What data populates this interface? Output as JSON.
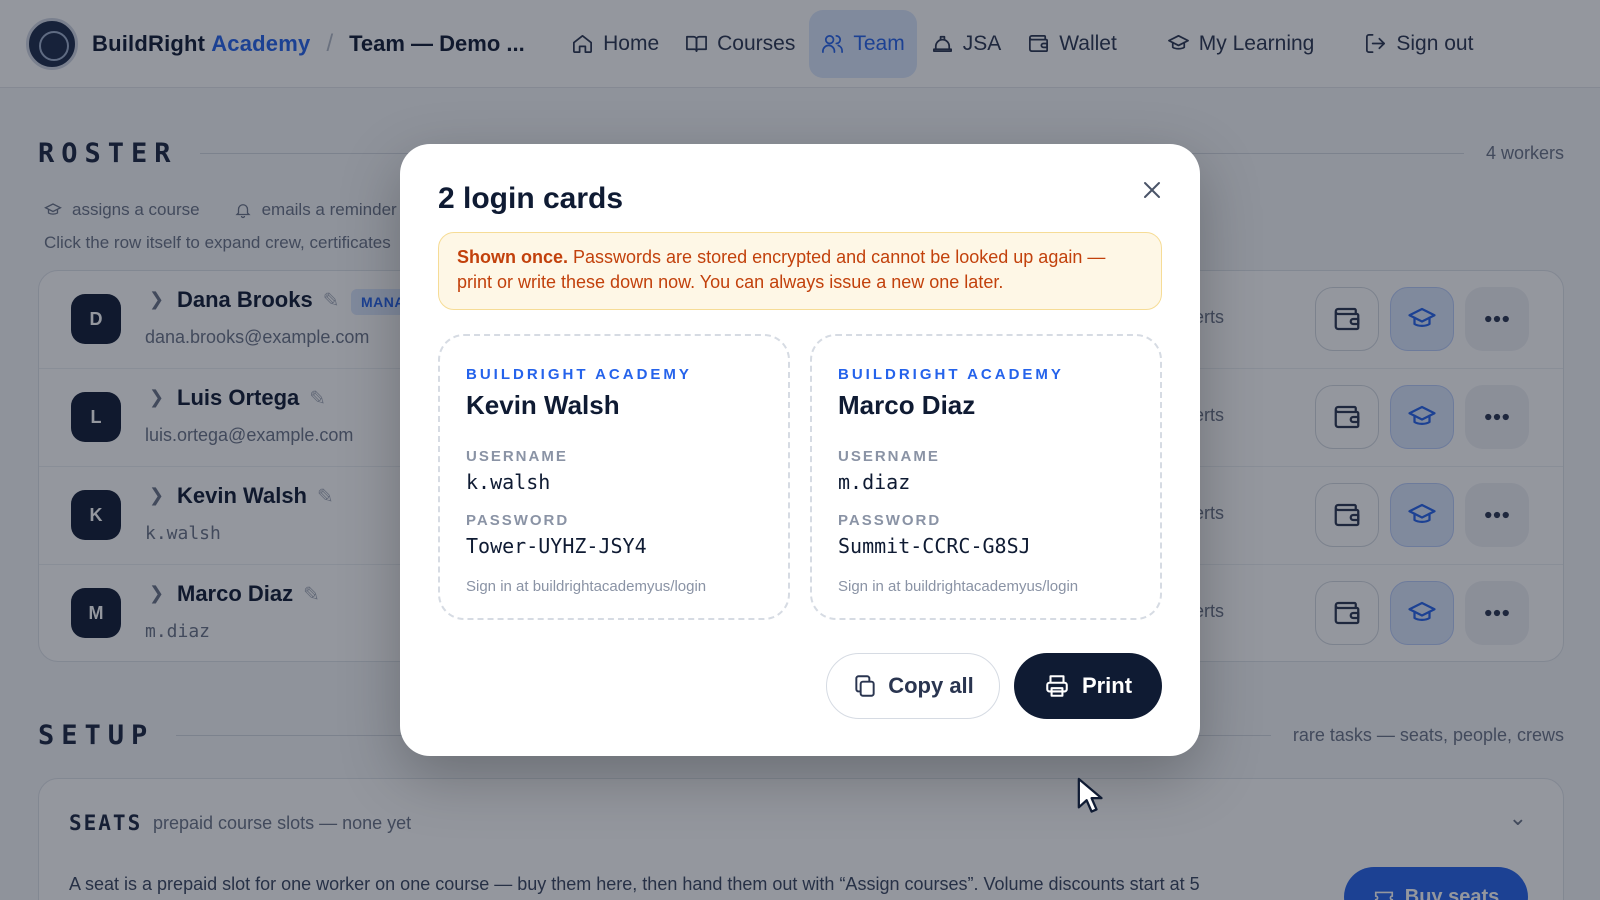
{
  "header": {
    "brand_part1": "BuildRight",
    "brand_part2": "Academy",
    "breadcrumb_separator": "/",
    "breadcrumb_current": "Team — Demo ...",
    "nav": [
      {
        "label": "Home",
        "icon": "home-icon",
        "active": false
      },
      {
        "label": "Courses",
        "icon": "book-icon",
        "active": false
      },
      {
        "label": "Team",
        "icon": "users-icon",
        "active": true
      },
      {
        "label": "JSA",
        "icon": "hard-hat-icon",
        "active": false
      },
      {
        "label": "Wallet",
        "icon": "wallet-icon",
        "active": false
      },
      {
        "label": "My Learning",
        "icon": "graduation-cap-icon",
        "active": false
      },
      {
        "label": "Sign out",
        "icon": "sign-out-icon",
        "active": false
      }
    ]
  },
  "roster": {
    "title": "ROSTER",
    "count": "4 workers",
    "legend": [
      {
        "icon": "graduation-cap-icon",
        "text": "assigns a course"
      },
      {
        "icon": "bell-icon",
        "text": "emails a reminder"
      }
    ],
    "hint": "Click  the row itself to expand crew, certificates",
    "workers": [
      {
        "initial": "D",
        "name": "Dana Brooks",
        "sub": "dana.brooks@example.com",
        "badge": "MANA",
        "certs": "erts"
      },
      {
        "initial": "L",
        "name": "Luis Ortega",
        "sub": "luis.ortega@example.com",
        "certs": "erts"
      },
      {
        "initial": "K",
        "name": "Kevin Walsh",
        "sub": "k.walsh",
        "certs": "erts"
      },
      {
        "initial": "M",
        "name": "Marco Diaz",
        "sub": "m.diaz",
        "certs": "erts"
      }
    ]
  },
  "setup": {
    "title": "SETUP",
    "meta": "rare tasks — seats, people, crews",
    "seats_title": "SEATS",
    "seats_sub": "prepaid course slots — none yet",
    "seats_desc": "A seat is a prepaid slot for one worker on one course — buy them here, then hand them out with “Assign courses”. Volume discounts start at 5",
    "buy_label": "Buy seats"
  },
  "modal": {
    "title": "2 login cards",
    "warning_strong": "Shown once.",
    "warning_text": " Passwords are stored encrypted and cannot be looked up again — print or write these down now. You can always issue a new one later.",
    "cards": [
      {
        "brand": "BUILDRIGHT ACADEMY",
        "name": "Kevin Walsh",
        "username_label": "USERNAME",
        "username": "k.walsh",
        "password_label": "PASSWORD",
        "password": "Tower-UYHZ-JSY4",
        "footer": "Sign in at buildrightacademyus/login"
      },
      {
        "brand": "BUILDRIGHT ACADEMY",
        "name": "Marco Diaz",
        "username_label": "USERNAME",
        "username": "m.diaz",
        "password_label": "PASSWORD",
        "password": "Summit-CCRC-G8SJ",
        "footer": "Sign in at buildrightacademyus/login"
      }
    ],
    "copy_label": "Copy all",
    "print_label": "Print"
  },
  "colors": {
    "accent": "#2563eb",
    "navy": "#0f1b33",
    "warning_bg": "#fef7e6",
    "warning_text": "#c2410c"
  }
}
